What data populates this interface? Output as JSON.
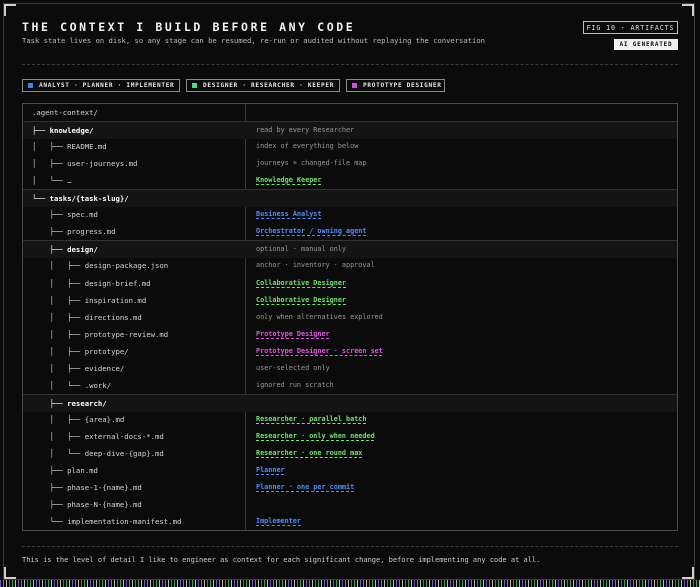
{
  "header": {
    "title": "THE CONTEXT I BUILD BEFORE ANY CODE",
    "subtitle": "Task state lives on disk, so any stage can be resumed, re-run or audited without replaying the conversation",
    "fig_label": "FIG 10 · ARTIFACTS",
    "badge": "AI GENERATED"
  },
  "legend": [
    {
      "label": "ANALYST · PLANNER · IMPLEMENTER",
      "color": "#3b82f6"
    },
    {
      "label": "DESIGNER · RESEARCHER · KEEPER",
      "color": "#4ade80"
    },
    {
      "label": "PROTOTYPE DESIGNER",
      "color": "#d946ef"
    }
  ],
  "colors": {
    "blue": "#4f8ef7",
    "green": "#6ee36e",
    "magenta": "#e055e0",
    "note": "#9a9a9a"
  },
  "rows": [
    {
      "tree": ".agent-context/",
      "note": "",
      "role": ""
    },
    {
      "tree": "├── knowledge/",
      "note": "read by every Researcher",
      "role": "",
      "bold": true
    },
    {
      "tree": "│   ├── README.md",
      "note": "index of everything below",
      "role": ""
    },
    {
      "tree": "│   ├── user-journeys.md",
      "note": "journeys + changed-file map",
      "role": ""
    },
    {
      "tree": "│   └── …",
      "note": "Knowledge Keeper",
      "role": "green"
    },
    {
      "tree": "└── tasks/{task-slug}/",
      "note": "",
      "role": "",
      "bold": true
    },
    {
      "tree": "    ├── spec.md",
      "note": "Business Analyst",
      "role": "blue"
    },
    {
      "tree": "    ├── progress.md",
      "note": "Orchestrator / owning agent",
      "role": "blue"
    },
    {
      "tree": "    ├── design/",
      "note": "optional · manual only",
      "role": "",
      "bold": true
    },
    {
      "tree": "    │   ├── design-package.json",
      "note": "anchor · inventory · approval",
      "role": ""
    },
    {
      "tree": "    │   ├── design-brief.md",
      "note": "Collaborative Designer",
      "role": "green"
    },
    {
      "tree": "    │   ├── inspiration.md",
      "note": "Collaborative Designer",
      "role": "green"
    },
    {
      "tree": "    │   ├── directions.md",
      "note": "only when alternatives explored",
      "role": ""
    },
    {
      "tree": "    │   ├── prototype-review.md",
      "note": "Prototype Designer",
      "role": "magenta"
    },
    {
      "tree": "    │   ├── prototype/",
      "note": "Prototype Designer · screen set",
      "role": "magenta"
    },
    {
      "tree": "    │   ├── evidence/",
      "note": "user-selected only",
      "role": ""
    },
    {
      "tree": "    │   └── .work/",
      "note": "ignored run scratch",
      "role": ""
    },
    {
      "tree": "    ├── research/",
      "note": "",
      "role": "",
      "bold": true
    },
    {
      "tree": "    │   ├── {area}.md",
      "note": "Researcher · parallel batch",
      "role": "green"
    },
    {
      "tree": "    │   ├── external-docs-*.md",
      "note": "Researcher · only when needed",
      "role": "green"
    },
    {
      "tree": "    │   └── deep-dive-{gap}.md",
      "note": "Researcher · one round max",
      "role": "green"
    },
    {
      "tree": "    ├── plan.md",
      "note": "Planner",
      "role": "blue"
    },
    {
      "tree": "    ├── phase-1-{name}.md",
      "note": "Planner · one per commit",
      "role": "blue"
    },
    {
      "tree": "    ├── phase-N-{name}.md",
      "note": "",
      "role": ""
    },
    {
      "tree": "    └── implementation-manifest.md",
      "note": "Implementer",
      "role": "blue"
    }
  ],
  "footer": "This is the level of detail I like to engineer as context for each significant change, before implementing any code at all."
}
